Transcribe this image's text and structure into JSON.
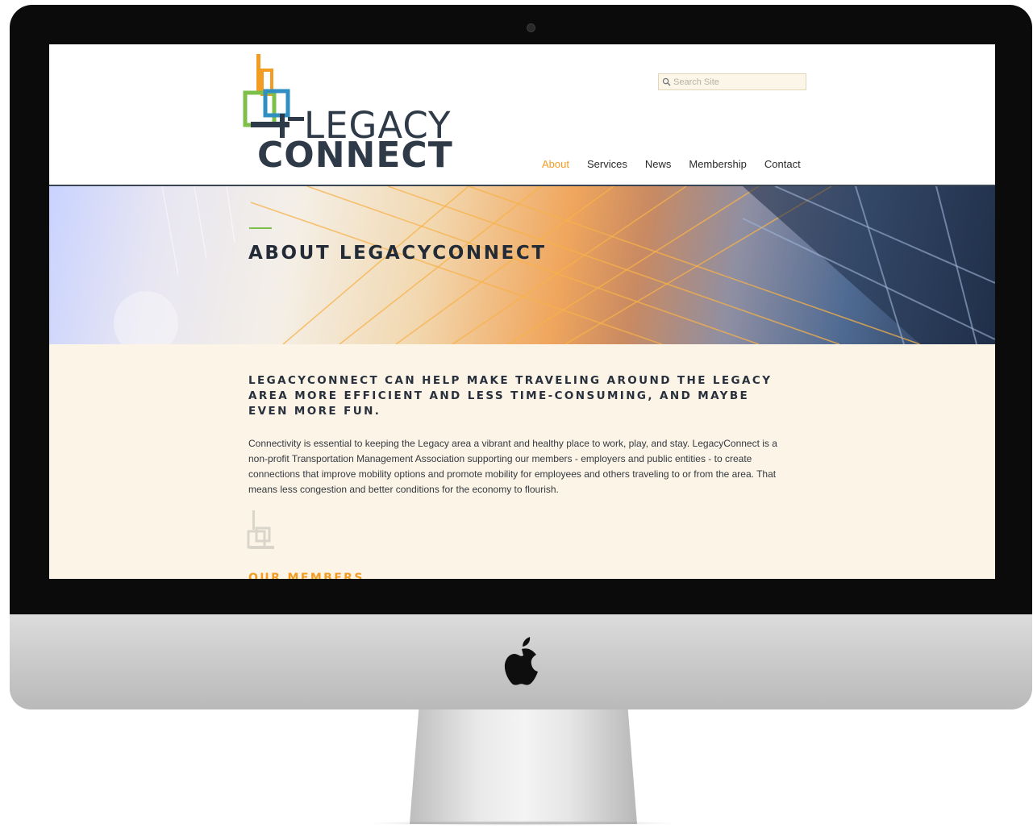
{
  "header": {
    "logo": {
      "line1": "LEGACY",
      "line2": "CONNECT"
    },
    "search": {
      "placeholder": "Search Site",
      "value": ""
    },
    "nav": [
      {
        "label": "About",
        "active": true
      },
      {
        "label": "Services",
        "active": false
      },
      {
        "label": "News",
        "active": false
      },
      {
        "label": "Membership",
        "active": false
      },
      {
        "label": "Contact",
        "active": false
      }
    ]
  },
  "hero": {
    "title": "ABOUT LEGACYCONNECT"
  },
  "main": {
    "lead": "LegacyConnect can help make traveling around the Legacy area more efficient and less time-consuming, and maybe even more fun.",
    "body": "Connectivity is essential to keeping the Legacy area a vibrant and healthy place to work, play, and stay. LegacyConnect is a non-profit Transportation Management Association supporting our members - employers and public entities - to create connections that improve mobility options and promote mobility for employees and others traveling to or from the area. That means less congestion and better conditions for the economy to flourish.",
    "members_heading": "OUR MEMBERS"
  },
  "colors": {
    "accent": "#f39c22",
    "logo_green": "#7cc04b",
    "logo_blue": "#2f8fc2",
    "logo_orange": "#f39c22",
    "dark_navy": "#2f3a48",
    "content_bg": "#fcf5e7"
  },
  "icons": {
    "search": "magnifier-icon",
    "hardware_logo": "apple-logo-icon"
  }
}
